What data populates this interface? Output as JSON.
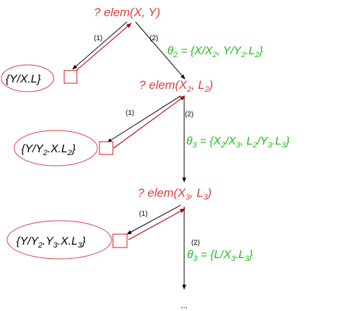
{
  "nodes": [
    {
      "goal": {
        "pre": "? elem(X, Y)"
      },
      "theta": {
        "s1": "θ",
        "s1sub": "2",
        "s2": " = {X/X",
        "s2sub": "2",
        "s3": ", Y/Y",
        "s3sub": "2",
        "s4": ".L",
        "s4sub": "2",
        "s5": "}"
      },
      "solution": {
        "pre": "{Y/X.L}"
      },
      "branch_labels": [
        "(1)",
        "(2)"
      ]
    },
    {
      "goal": {
        "pre": "? elem(X",
        "sub1": "2",
        "mid": ", L",
        "sub2": "2",
        "post": ")"
      },
      "theta": {
        "s1": "θ",
        "s1sub": "3",
        "s2": " = {X",
        "s2sub": "2",
        "s3": "/X",
        "s3sub": "3",
        "s4": ", L",
        "s4sub": "2",
        "s5": "/Y",
        "s5sub": "3",
        "s6": ".L",
        "s6sub": "3",
        "s7": "}"
      },
      "solution": {
        "pre": "{Y/Y",
        "sub1": "2",
        "mid": ".X.L",
        "sub2": "2",
        "post": "}"
      },
      "branch_labels": [
        "(1)",
        "(2)"
      ]
    },
    {
      "goal": {
        "pre": "? elem(X",
        "sub1": "3",
        "mid": ", L",
        "sub2": "3",
        "post": ")"
      },
      "theta": {
        "s1": "θ",
        "s1sub": "3",
        "s2": " = {L/X",
        "s2sub": "3",
        "s3": ".L",
        "s3sub": "3",
        "s4": "}"
      },
      "solution": {
        "pre": "{Y/Y",
        "sub1": "2",
        "mid": ".Y",
        "sub2": "3",
        "mid2": ".X.L",
        "sub3": "3",
        "post": "}"
      },
      "branch_labels": [
        "(1)",
        "(2)"
      ]
    }
  ],
  "continuation": "..."
}
